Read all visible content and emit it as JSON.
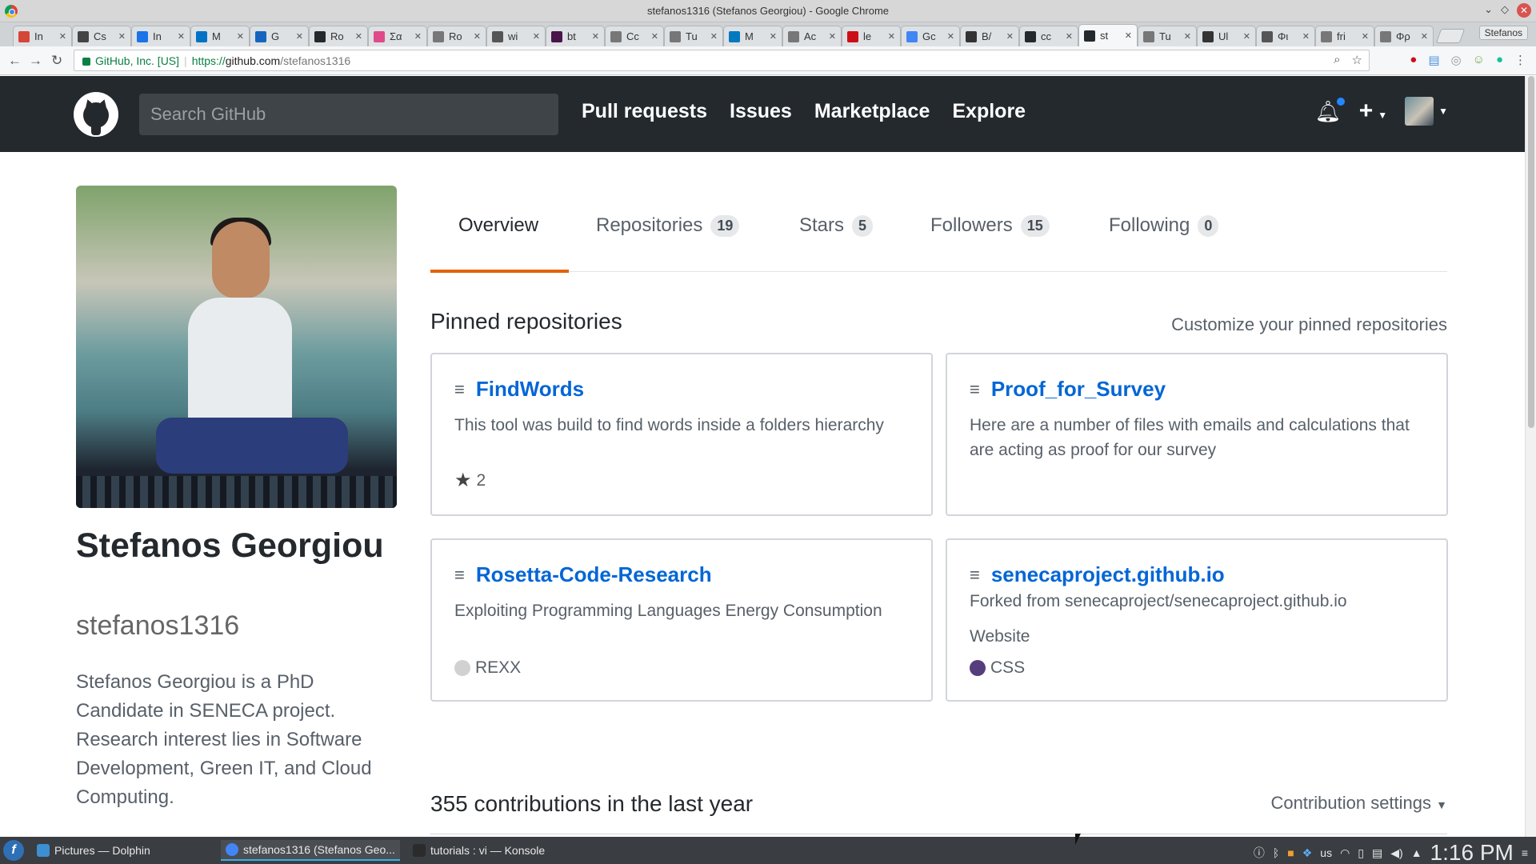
{
  "window": {
    "title": "stefanos1316 (Stefanos Georgiou) - Google Chrome"
  },
  "browser": {
    "tabs": [
      {
        "label": "In",
        "icon": "gmail-icon",
        "color": "#d44638"
      },
      {
        "label": "Cs",
        "icon": "acrobat-icon",
        "color": "#444444"
      },
      {
        "label": "In",
        "icon": "mail-icon",
        "color": "#1a73e8"
      },
      {
        "label": "M",
        "icon": "outlook-icon",
        "color": "#0072c6"
      },
      {
        "label": "G",
        "icon": "docs-icon",
        "color": "#1565c0"
      },
      {
        "label": "Ro",
        "icon": "github-icon",
        "color": "#24292e"
      },
      {
        "label": "Σα",
        "icon": "circle-icon",
        "color": "#e04a8a"
      },
      {
        "label": "Ro",
        "icon": "page-icon",
        "color": "#777777"
      },
      {
        "label": "wi",
        "icon": "wiki-icon",
        "color": "#555555"
      },
      {
        "label": "bt",
        "icon": "slack-icon",
        "color": "#4a154b"
      },
      {
        "label": "Cc",
        "icon": "page-icon",
        "color": "#777777"
      },
      {
        "label": "Tu",
        "icon": "page-icon",
        "color": "#777777"
      },
      {
        "label": "M",
        "icon": "trello-icon",
        "color": "#0079bf"
      },
      {
        "label": "Ac",
        "icon": "page-icon",
        "color": "#777777"
      },
      {
        "label": "le",
        "icon": "opera-icon",
        "color": "#cc0f16"
      },
      {
        "label": "Gc",
        "icon": "translate-icon",
        "color": "#4285f4"
      },
      {
        "label": "B/",
        "icon": "search-icon",
        "color": "#333333"
      },
      {
        "label": "cc",
        "icon": "github-icon",
        "color": "#24292e"
      },
      {
        "label": "st",
        "icon": "github-icon",
        "color": "#24292e",
        "active": true
      },
      {
        "label": "Tu",
        "icon": "page-icon",
        "color": "#777777"
      },
      {
        "label": "Ul",
        "icon": "rc-icon",
        "color": "#333333"
      },
      {
        "label": "Φι",
        "icon": "grid-icon",
        "color": "#555555"
      },
      {
        "label": "fri",
        "icon": "page-icon",
        "color": "#777777"
      },
      {
        "label": "Φρ",
        "icon": "page-icon",
        "color": "#777777"
      }
    ],
    "profile_name": "Stefanos",
    "security_label": "GitHub, Inc. [US]",
    "url_scheme": "https://",
    "url_host": "github.com",
    "url_path": "/stefanos1316"
  },
  "github": {
    "search_placeholder": "Search GitHub",
    "nav": [
      "Pull requests",
      "Issues",
      "Marketplace",
      "Explore"
    ],
    "accent_color": "#e36209",
    "link_color": "#0366d6"
  },
  "profile": {
    "name": "Stefanos Georgiou",
    "login": "stefanos1316",
    "bio": "Stefanos Georgiou is a PhD Candidate in SENECA project. Research interest lies in Software Development, Green IT, and Cloud Computing."
  },
  "tabs": [
    {
      "label": "Overview",
      "count": null,
      "selected": true
    },
    {
      "label": "Repositories",
      "count": "19"
    },
    {
      "label": "Stars",
      "count": "5"
    },
    {
      "label": "Followers",
      "count": "15"
    },
    {
      "label": "Following",
      "count": "0"
    }
  ],
  "pinned": {
    "title": "Pinned repositories",
    "customize": "Customize your pinned repositories",
    "repos": [
      {
        "name": "FindWords",
        "description": "This tool was build to find words inside a folders hierarchy",
        "stars": "2"
      },
      {
        "name": "Proof_for_Survey",
        "description": "Here are a number of files with emails and calculations that are acting as proof for our survey"
      },
      {
        "name": "Rosetta-Code-Research",
        "description": "Exploiting Programming Languages Energy Consumption",
        "language": "REXX",
        "language_color": "#d1d1d1"
      },
      {
        "name": "senecaproject.github.io",
        "forked_from": "Forked from senecaproject/senecaproject.github.io",
        "description": "Website",
        "language": "CSS",
        "language_color": "#563d7c"
      }
    ]
  },
  "contributions": {
    "title": "355 contributions in the last year",
    "settings": "Contribution settings"
  },
  "taskbar": {
    "tasks": [
      {
        "label": "Pictures — Dolphin",
        "icon": "folder-icon",
        "color": "#3d8fd1"
      },
      {
        "label": "stefanos1316 (Stefanos Geo...",
        "icon": "chrome-icon",
        "color": "#4285f4",
        "active": true
      },
      {
        "label": "tutorials : vi — Konsole",
        "icon": "terminal-icon",
        "color": "#2b2b2b"
      }
    ],
    "keyboard_layout": "us",
    "clock": "1:16 PM"
  }
}
